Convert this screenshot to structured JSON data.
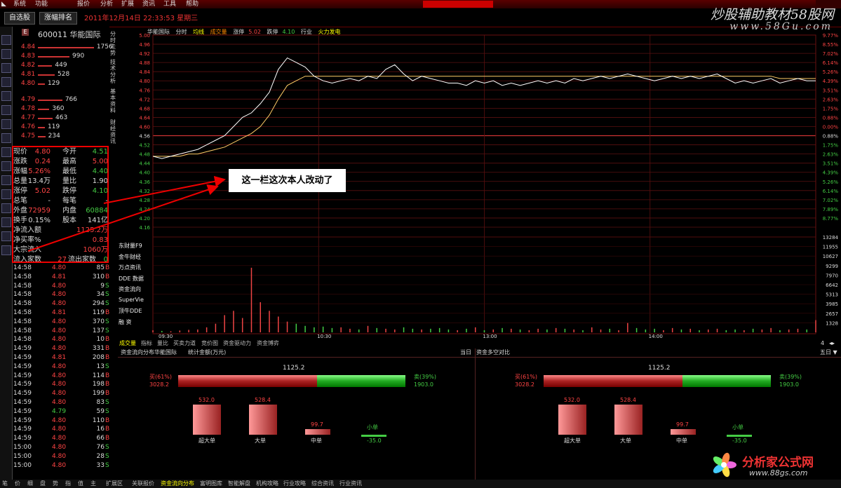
{
  "menu": [
    "系统",
    "功能",
    "报价",
    "分析",
    "扩展",
    "资讯",
    "工具",
    "帮助"
  ],
  "tabs": {
    "t1": "自选股",
    "t2": "涨幅排名"
  },
  "datetime": "2011年12月14日 22:33:53 星期三",
  "brand": {
    "title": "炒股辅助教材58股网",
    "url": "www.58Gu.com"
  },
  "stock": {
    "badge": "E",
    "code": "600011 华能国际"
  },
  "sells": [
    {
      "p": "4.84",
      "v": "1756"
    },
    {
      "p": "4.83",
      "v": "990"
    },
    {
      "p": "4.82",
      "v": "449"
    },
    {
      "p": "4.81",
      "v": "528"
    },
    {
      "p": "4.80",
      "v": "129"
    }
  ],
  "buys": [
    {
      "p": "4.79",
      "v": "766"
    },
    {
      "p": "4.78",
      "v": "360"
    },
    {
      "p": "4.77",
      "v": "463"
    },
    {
      "p": "4.76",
      "v": "119"
    },
    {
      "p": "4.75",
      "v": "234"
    }
  ],
  "stats": [
    {
      "l": "现价",
      "lv": "4.80",
      "r": "今开",
      "rv": "4.51",
      "lc": "#f44",
      "rc": "#4c4"
    },
    {
      "l": "涨跌",
      "lv": "0.24",
      "r": "最高",
      "rv": "5.00",
      "lc": "#f44",
      "rc": "#f44"
    },
    {
      "l": "涨幅",
      "lv": "5.26%",
      "r": "最低",
      "rv": "4.40",
      "lc": "#f44",
      "rc": "#4c4"
    },
    {
      "l": "总量",
      "lv": "13.4万",
      "r": "量比",
      "rv": "1.90",
      "lc": "#ddd",
      "rc": "#ddd"
    },
    {
      "l": "涨停",
      "lv": "5.02",
      "r": "跌停",
      "rv": "4.10",
      "lc": "#f44",
      "rc": "#4c4"
    },
    {
      "l": "总笔",
      "lv": "-",
      "r": "每笔",
      "rv": "-",
      "lc": "#ddd",
      "rc": "#ddd"
    },
    {
      "l": "外盘",
      "lv": "72959",
      "r": "内盘",
      "rv": "60884",
      "lc": "#f44",
      "rc": "#4c4"
    },
    {
      "l": "换手",
      "lv": "0.15%",
      "r": "股本",
      "rv": "141亿",
      "lc": "#ddd",
      "rc": "#ddd"
    }
  ],
  "flowstats": [
    {
      "l": "净流入额",
      "v": "1125.2万"
    },
    {
      "l": "净买率%",
      "v": "0.83"
    },
    {
      "l": "大宗流入",
      "v": "1060万"
    }
  ],
  "inflow": {
    "l": "流入家数",
    "v": "27",
    "r": "流出家数",
    "rv": "0"
  },
  "ticks": [
    [
      "14:58",
      "4.80",
      "85",
      "B"
    ],
    [
      "14:58",
      "4.81",
      "310",
      "B"
    ],
    [
      "14:58",
      "4.80",
      "9",
      "S"
    ],
    [
      "14:58",
      "4.80",
      "34",
      "S"
    ],
    [
      "14:58",
      "4.80",
      "294",
      "S"
    ],
    [
      "14:58",
      "4.81",
      "119",
      "B"
    ],
    [
      "14:58",
      "4.80",
      "370",
      "S"
    ],
    [
      "14:58",
      "4.80",
      "137",
      "S"
    ],
    [
      "14:58",
      "4.80",
      "10",
      "B"
    ],
    [
      "14:59",
      "4.80",
      "331",
      "B"
    ],
    [
      "14:59",
      "4.81",
      "208",
      "B"
    ],
    [
      "14:59",
      "4.80",
      "13",
      "S"
    ],
    [
      "14:59",
      "4.80",
      "114",
      "B"
    ],
    [
      "14:59",
      "4.80",
      "198",
      "B"
    ],
    [
      "14:59",
      "4.80",
      "199",
      "B"
    ],
    [
      "14:59",
      "4.80",
      "83",
      "S"
    ],
    [
      "14:59",
      "4.79",
      "59",
      "S"
    ],
    [
      "14:59",
      "4.80",
      "110",
      "B"
    ],
    [
      "14:59",
      "4.80",
      "16",
      "B"
    ],
    [
      "14:59",
      "4.80",
      "66",
      "B"
    ],
    [
      "15:00",
      "4.80",
      "76",
      "S"
    ],
    [
      "15:00",
      "4.80",
      "28",
      "S"
    ],
    [
      "15:00",
      "4.80",
      "33",
      "S"
    ]
  ],
  "vtabs": [
    "分时走势",
    "技术分析",
    "基本资料",
    "财经资讯"
  ],
  "chartTitle": {
    "name": "华能国际",
    "mode": "分时",
    "avg": "均线",
    "vol": "成交量",
    "up": "涨停",
    "upv": "5.02",
    "down": "跌停",
    "downv": "4.10",
    "ind": "行业",
    "fire": "火力发电"
  },
  "annotation": "这一栏这次本人改动了",
  "indicators": [
    "东财量F9",
    "金牛财经",
    "万点资讯",
    "DDE 数据",
    "资金流向",
    "SuperVie",
    "顶牛DDE",
    "融  资"
  ],
  "chart_data": {
    "type": "line",
    "title": "",
    "x_ticks": [
      "09:30",
      "10:30",
      "13:00",
      "14:00"
    ],
    "y_ticks": [
      "4.96",
      "4.92",
      "4.88",
      "4.84",
      "4.80",
      "4.76",
      "4.72",
      "4.68",
      "4.64",
      "4.60",
      "4.56",
      "4.52",
      "4.48",
      "4.44",
      "4.40",
      "4.36",
      "4.32",
      "4.28",
      "4.24",
      "4.20",
      "4.16"
    ],
    "y_labels": [
      "5.00",
      "4.96",
      "4.92",
      "4.88",
      "4.84",
      "4.80",
      "4.76",
      "4.72",
      "4.68",
      "4.64",
      "4.60",
      "4.56",
      "4.52",
      "4.48",
      "4.44",
      "4.40",
      "4.36",
      "4.32",
      "4.28",
      "4.24",
      "4.20",
      "4.16"
    ],
    "pct_labels": [
      "9.77%",
      "8.55%",
      "7.02%",
      "6.14%",
      "5.26%",
      "4.39%",
      "3.51%",
      "2.63%",
      "1.75%",
      "0.88%",
      "0.00%",
      "0.88%",
      "1.75%",
      "2.63%",
      "3.51%",
      "4.39%",
      "5.26%",
      "6.14%",
      "7.02%",
      "7.89%",
      "8.77%"
    ],
    "ylim": [
      4.16,
      5.0
    ],
    "prev_close": 4.56,
    "price": [
      4.47,
      4.46,
      4.47,
      4.48,
      4.49,
      4.5,
      4.52,
      4.54,
      4.56,
      4.6,
      4.64,
      4.66,
      4.7,
      4.75,
      4.85,
      4.9,
      4.88,
      4.86,
      4.82,
      4.8,
      4.79,
      4.8,
      4.81,
      4.8,
      4.82,
      4.81,
      4.85,
      4.87,
      4.83,
      4.8,
      4.82,
      4.81,
      4.8,
      4.79,
      4.79,
      4.78,
      4.8,
      4.79,
      4.8,
      4.78,
      4.79,
      4.78,
      4.79,
      4.8,
      4.79,
      4.8,
      4.79,
      4.81,
      4.8,
      4.81,
      4.82,
      4.81,
      4.82,
      4.83,
      4.82,
      4.81,
      4.8,
      4.81,
      4.82,
      4.81,
      4.82,
      4.81,
      4.82,
      4.83,
      4.81,
      4.79,
      4.8,
      4.79,
      4.8,
      4.81,
      4.79,
      4.8,
      4.81,
      4.8,
      4.8
    ],
    "avg": [
      4.47,
      4.47,
      4.47,
      4.47,
      4.48,
      4.48,
      4.49,
      4.5,
      4.51,
      4.53,
      4.55,
      4.57,
      4.6,
      4.65,
      4.72,
      4.78,
      4.8,
      4.82,
      4.82,
      4.82,
      4.82,
      4.82,
      4.82,
      4.82,
      4.82,
      4.82,
      4.82,
      4.82,
      4.82,
      4.82,
      4.82,
      4.82,
      4.82,
      4.82,
      4.82,
      4.82,
      4.82,
      4.82,
      4.82,
      4.82,
      4.82,
      4.82,
      4.82,
      4.82,
      4.82,
      4.82,
      4.82,
      4.82,
      4.82,
      4.82,
      4.82,
      4.82,
      4.82,
      4.82,
      4.82,
      4.82,
      4.82,
      4.82,
      4.82,
      4.82,
      4.82,
      4.82,
      4.82,
      4.82,
      4.82,
      4.82,
      4.82,
      4.82,
      4.82,
      4.82,
      4.81,
      4.81,
      4.81,
      4.81,
      4.81
    ],
    "vol_ticks": [
      "13284",
      "11955",
      "10627",
      "9299",
      "7970",
      "6642",
      "5313",
      "3985",
      "2657",
      "1328"
    ],
    "volume": [
      300,
      200,
      150,
      260,
      350,
      400,
      700,
      1200,
      2400,
      3000,
      2000,
      9000,
      4200,
      3000,
      2200,
      1500,
      1200,
      900,
      700,
      800,
      600,
      700,
      500,
      400,
      900,
      600,
      500,
      400,
      700,
      500,
      400,
      500,
      600,
      400,
      300,
      500,
      700,
      300,
      400,
      600,
      500,
      400,
      300,
      500,
      400,
      600,
      500,
      400,
      300,
      700,
      400,
      500,
      300,
      1300,
      600,
      400,
      500,
      300,
      600,
      400,
      500,
      300,
      400,
      500,
      300,
      400,
      300,
      500,
      400,
      600,
      300,
      400,
      500,
      400,
      1700
    ]
  },
  "tabs1": [
    "成交量",
    "指标",
    "量比",
    "买卖力道",
    "竞价图",
    "资金驱动力",
    "资金博弈"
  ],
  "tabs1_right": "4",
  "flowhdr": {
    "left": [
      "资金流向分布",
      "华能国际",
      "统计金额(万元)"
    ],
    "mid": "当日",
    "right": "资金多空对比",
    "end": "五日 ▼"
  },
  "flowbars": {
    "net": "1125.2",
    "buy_label": "买(61%)",
    "buy": "3028.2",
    "sell_label": "卖(39%)",
    "sell": "1903.0",
    "cats": [
      {
        "name": "超大单",
        "v": "532.0"
      },
      {
        "name": "大单",
        "v": "528.4"
      },
      {
        "name": "中单",
        "v": "99.7"
      },
      {
        "name": "小单",
        "v": "-35.0"
      }
    ]
  },
  "bottombar": [
    "笔",
    "价",
    "细",
    "盘",
    "势",
    "指",
    "值",
    "主",
    "扩展区",
    "关联报价",
    "资金流向分布",
    "富明图库",
    "智能解盘",
    "机构攻略",
    "行业攻略",
    "综合资讯",
    "行业资讯"
  ],
  "logo": {
    "main": "分析家公式网",
    "url": "www.88gs.com"
  }
}
